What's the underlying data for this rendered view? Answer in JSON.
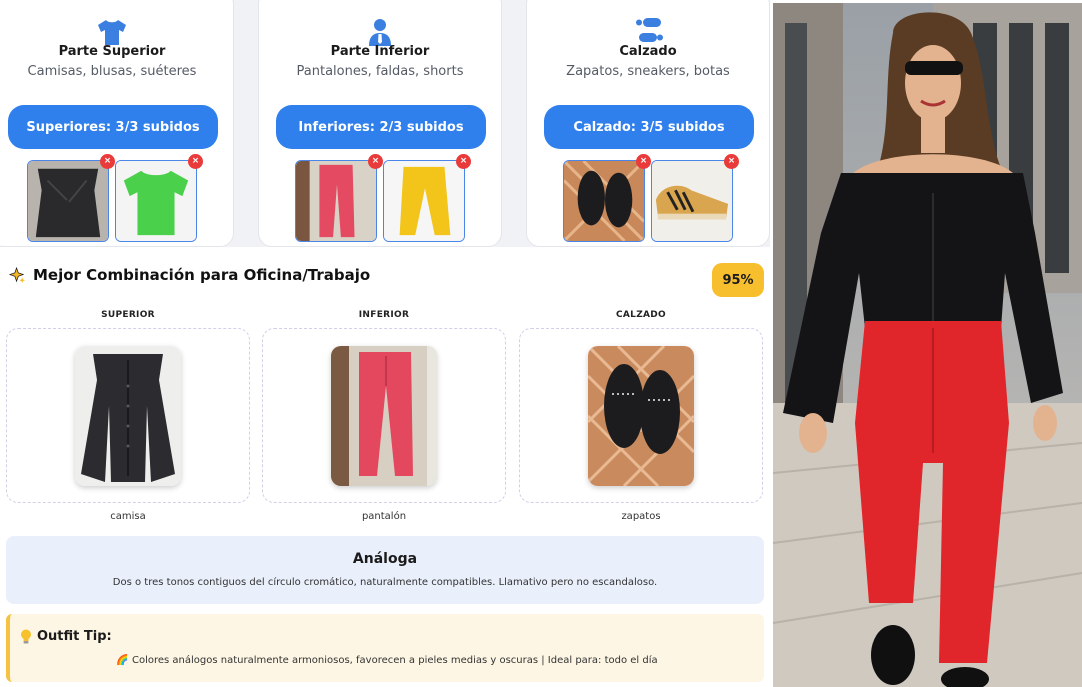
{
  "categories": [
    {
      "title": "Parte Superior",
      "subtitle": "Camisas, blusas, suéteres",
      "button": "Superiores: 3/3 subidos",
      "icon": "tshirt-icon"
    },
    {
      "title": "Parte Inferior",
      "subtitle": "Pantalones, faldas, shorts",
      "button": "Inferiores: 2/3 subidos",
      "icon": "person-icon"
    },
    {
      "title": "Calzado",
      "subtitle": "Zapatos, sneakers, botas",
      "button": "Calzado: 3/5 subidos",
      "icon": "footprints-icon"
    }
  ],
  "delete_symbol": "×",
  "result": {
    "title": "Mejor Combinación para Oficina/Trabajo",
    "score": "95%",
    "columns": [
      {
        "header": "SUPERIOR",
        "label": "camisa"
      },
      {
        "header": "INFERIOR",
        "label": "pantalón"
      },
      {
        "header": "CALZADO",
        "label": "zapatos"
      }
    ]
  },
  "harmony": {
    "title": "Análoga",
    "description": "Dos o tres tonos contiguos del círculo cromático, naturalmente compatibles. Llamativo pero no escandaloso."
  },
  "tip": {
    "title": "Outfit Tip:",
    "text": "🌈 Colores análogos naturalmente armoniosos, favorecen a pieles medias y oscuras | Ideal para: todo el día"
  },
  "colors": {
    "accent": "#2f80ed",
    "score_badge": "#f7be2d",
    "delete": "#ea3b3b",
    "harmony_bg": "#e9effb",
    "tip_bg": "#fdf6e4"
  }
}
